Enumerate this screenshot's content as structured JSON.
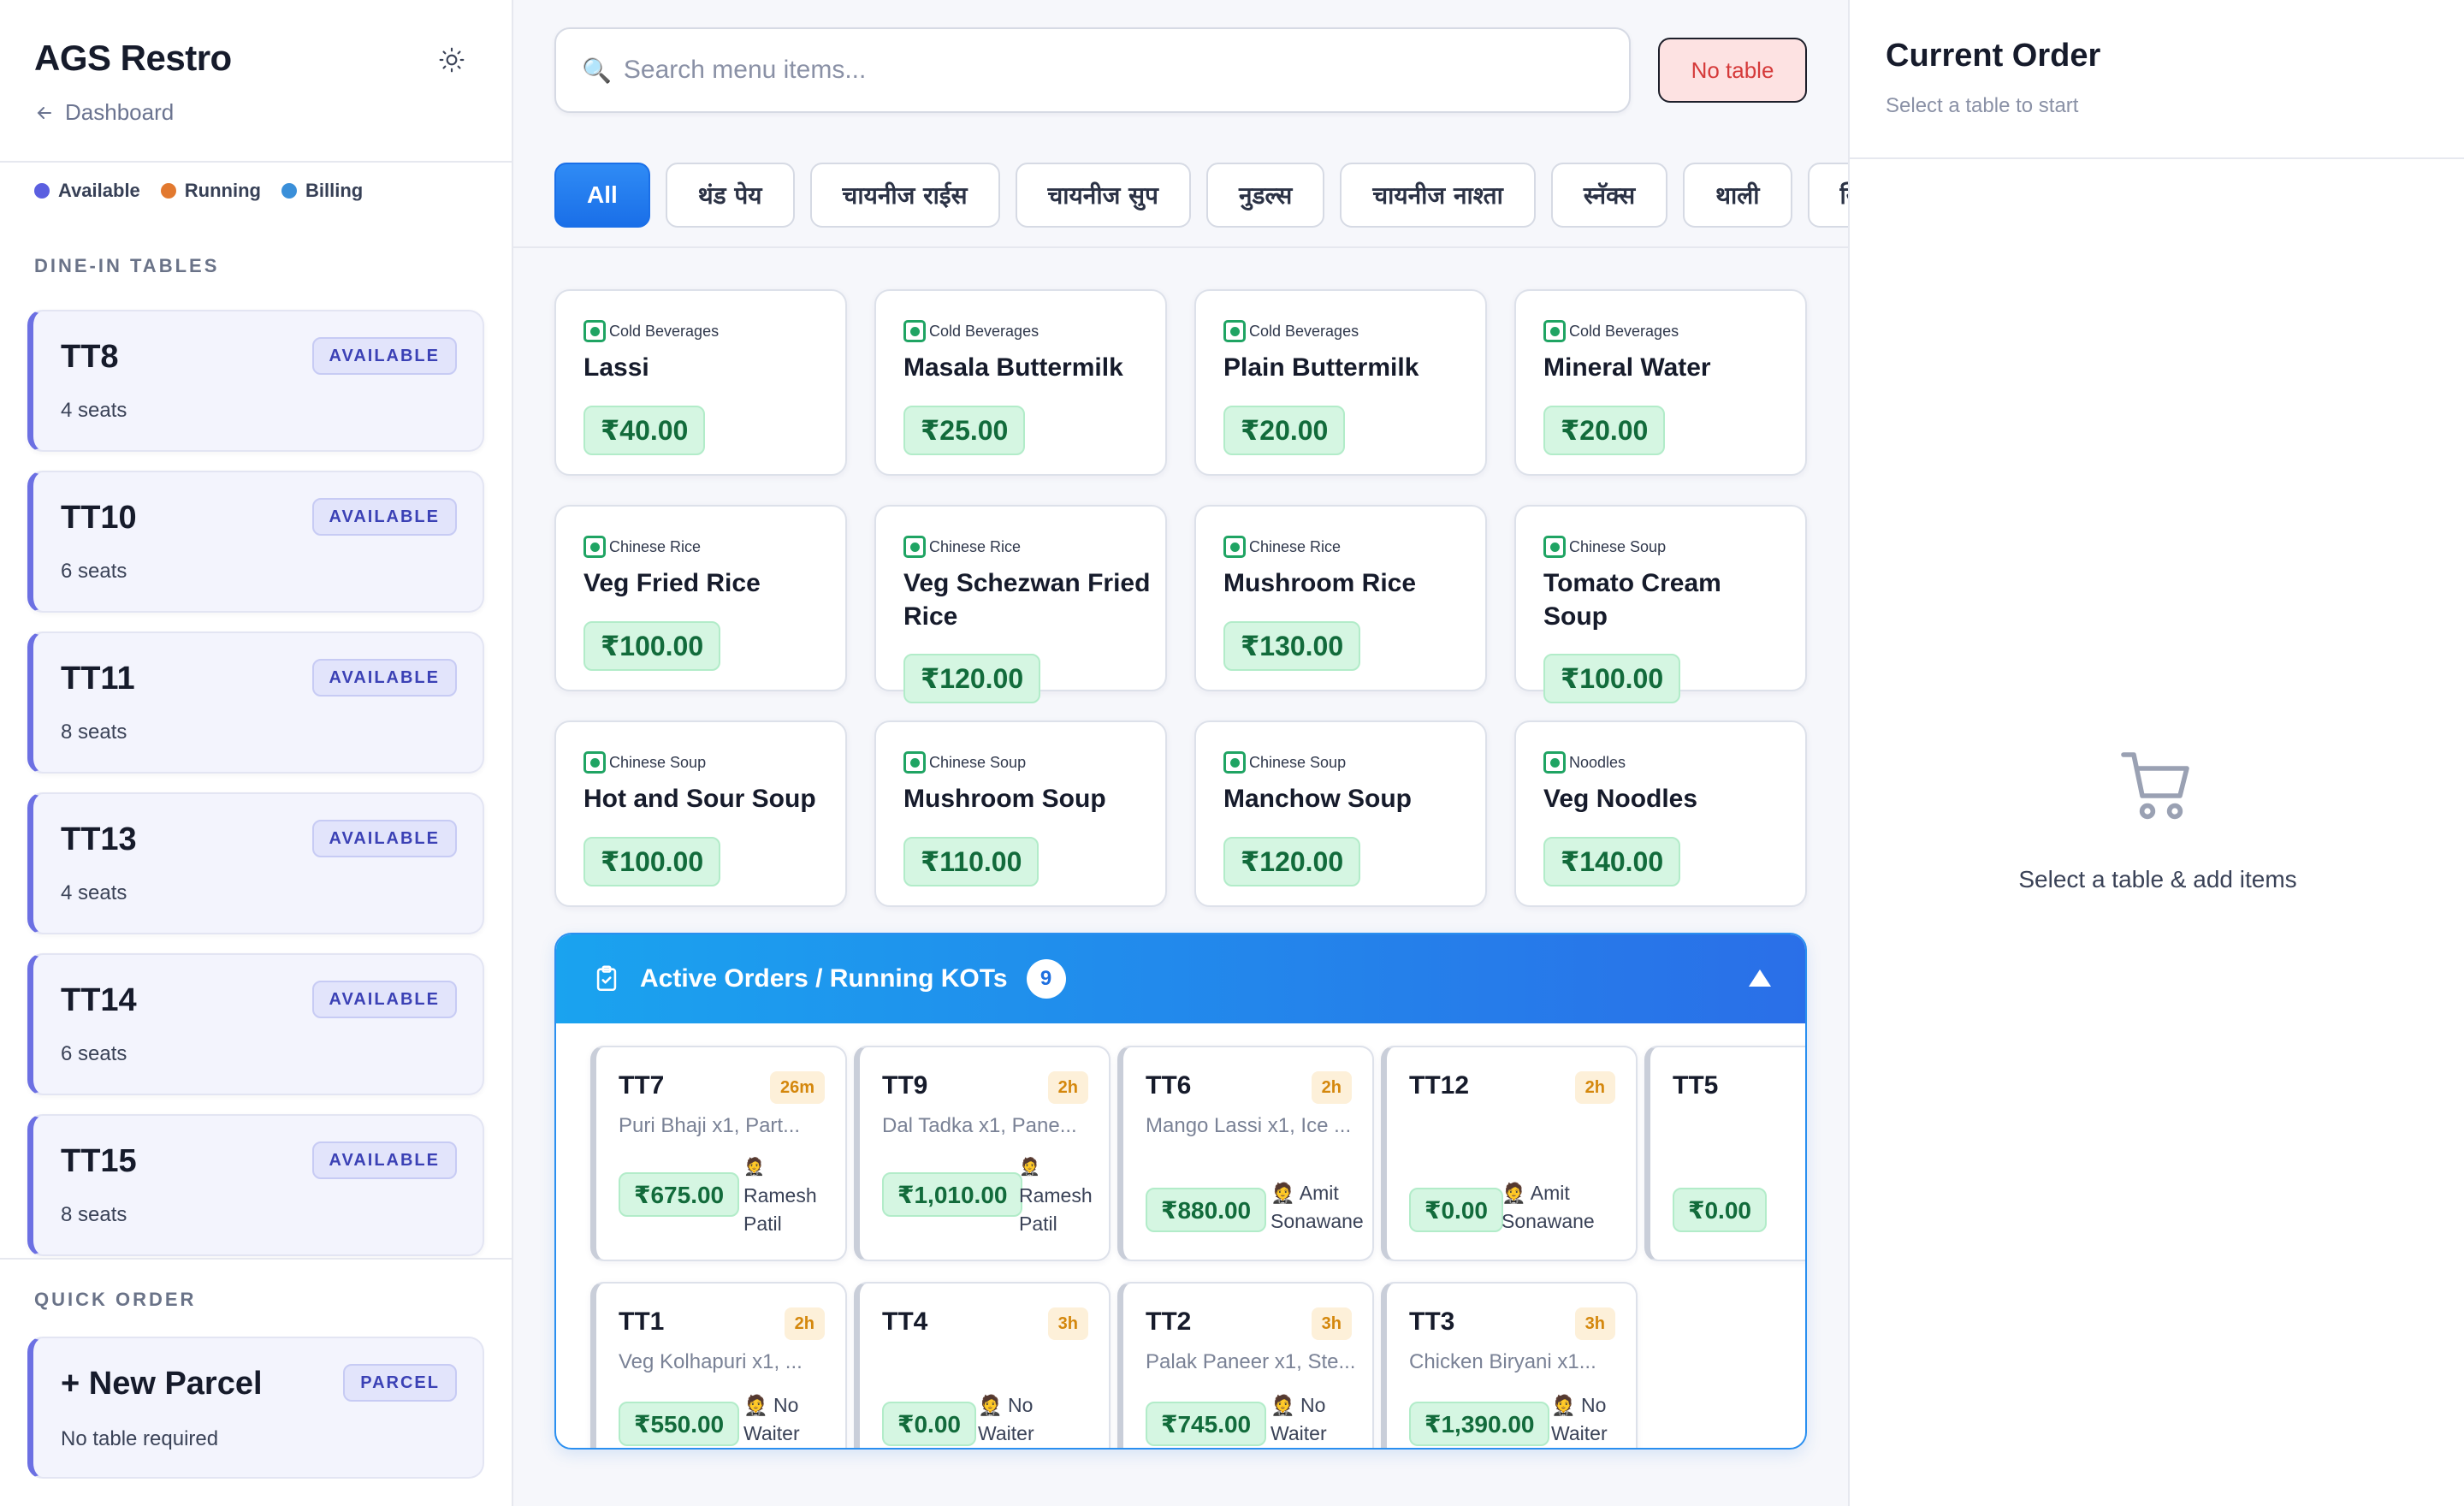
{
  "sidebar": {
    "brand": "AGS Restro",
    "back_label": "Dashboard",
    "legend": [
      {
        "label": "Available",
        "color": "#5b5fe0"
      },
      {
        "label": "Running",
        "color": "#e2792f"
      },
      {
        "label": "Billing",
        "color": "#3a8fd9"
      }
    ],
    "dine_in_title": "DINE-IN TABLES",
    "tables": [
      {
        "name": "TT8",
        "seats": "4 seats",
        "status": "AVAILABLE"
      },
      {
        "name": "TT10",
        "seats": "6 seats",
        "status": "AVAILABLE"
      },
      {
        "name": "TT11",
        "seats": "8 seats",
        "status": "AVAILABLE"
      },
      {
        "name": "TT13",
        "seats": "4 seats",
        "status": "AVAILABLE"
      },
      {
        "name": "TT14",
        "seats": "6 seats",
        "status": "AVAILABLE"
      },
      {
        "name": "TT15",
        "seats": "8 seats",
        "status": "AVAILABLE"
      }
    ],
    "quick_order_title": "QUICK ORDER",
    "quick_order": {
      "label": "+ New Parcel",
      "badge": "PARCEL",
      "sub": "No table required"
    }
  },
  "main": {
    "search_placeholder": "Search menu items...",
    "no_table_label": "No table",
    "categories": [
      "All",
      "थंड पेय",
      "चायनीज राईस",
      "चायनीज सुप",
      "नुडल्स",
      "चायनीज नाश्ता",
      "स्नॅक्स",
      "थाली",
      "स्विट"
    ],
    "items": [
      {
        "category": "Cold Beverages",
        "name": "Lassi",
        "price": "₹40.00"
      },
      {
        "category": "Cold Beverages",
        "name": "Masala Buttermilk",
        "price": "₹25.00"
      },
      {
        "category": "Cold Beverages",
        "name": "Plain Buttermilk",
        "price": "₹20.00"
      },
      {
        "category": "Cold Beverages",
        "name": "Mineral Water",
        "price": "₹20.00"
      },
      {
        "category": "Chinese Rice",
        "name": "Veg Fried Rice",
        "price": "₹100.00"
      },
      {
        "category": "Chinese Rice",
        "name": "Veg Schezwan Fried Rice",
        "price": "₹120.00"
      },
      {
        "category": "Chinese Rice",
        "name": "Mushroom Rice",
        "price": "₹130.00"
      },
      {
        "category": "Chinese Soup",
        "name": "Tomato Cream Soup",
        "price": "₹100.00"
      },
      {
        "category": "Chinese Soup",
        "name": "Hot and Sour Soup",
        "price": "₹100.00"
      },
      {
        "category": "Chinese Soup",
        "name": "Mushroom Soup",
        "price": "₹110.00"
      },
      {
        "category": "Chinese Soup",
        "name": "Manchow Soup",
        "price": "₹120.00"
      },
      {
        "category": "Noodles",
        "name": "Veg Noodles",
        "price": "₹140.00"
      }
    ],
    "active_orders": {
      "title": "Active Orders / Running KOTs",
      "count": "9",
      "orders": [
        {
          "table": "TT7",
          "time": "26m",
          "items": "Puri Bhaji x1, Part...",
          "total": "₹675.00",
          "waiter": "Ramesh Patil"
        },
        {
          "table": "TT9",
          "time": "2h",
          "items": "Dal Tadka x1, Pane...",
          "total": "₹1,010.00",
          "waiter": "Ramesh Patil"
        },
        {
          "table": "TT6",
          "time": "2h",
          "items": "Mango Lassi x1, Ice ...",
          "total": "₹880.00",
          "waiter": "Amit Sonawane"
        },
        {
          "table": "TT12",
          "time": "2h",
          "items": "",
          "total": "₹0.00",
          "waiter": "Amit Sonawane"
        },
        {
          "table": "TT5",
          "time": "",
          "items": "",
          "total": "₹0.00",
          "waiter": ""
        },
        {
          "table": "TT1",
          "time": "2h",
          "items": "Veg Kolhapuri x1, ...",
          "total": "₹550.00",
          "waiter": "No Waiter"
        },
        {
          "table": "TT4",
          "time": "3h",
          "items": "",
          "total": "₹0.00",
          "waiter": "No Waiter"
        },
        {
          "table": "TT2",
          "time": "3h",
          "items": "Palak Paneer x1, Ste...",
          "total": "₹745.00",
          "waiter": "No Waiter"
        },
        {
          "table": "TT3",
          "time": "3h",
          "items": "Chicken Biryani x1...",
          "total": "₹1,390.00",
          "waiter": "No Waiter"
        }
      ]
    }
  },
  "order_panel": {
    "title": "Current Order",
    "subtitle": "Select a table to start",
    "empty_text": "Select a table & add items"
  }
}
